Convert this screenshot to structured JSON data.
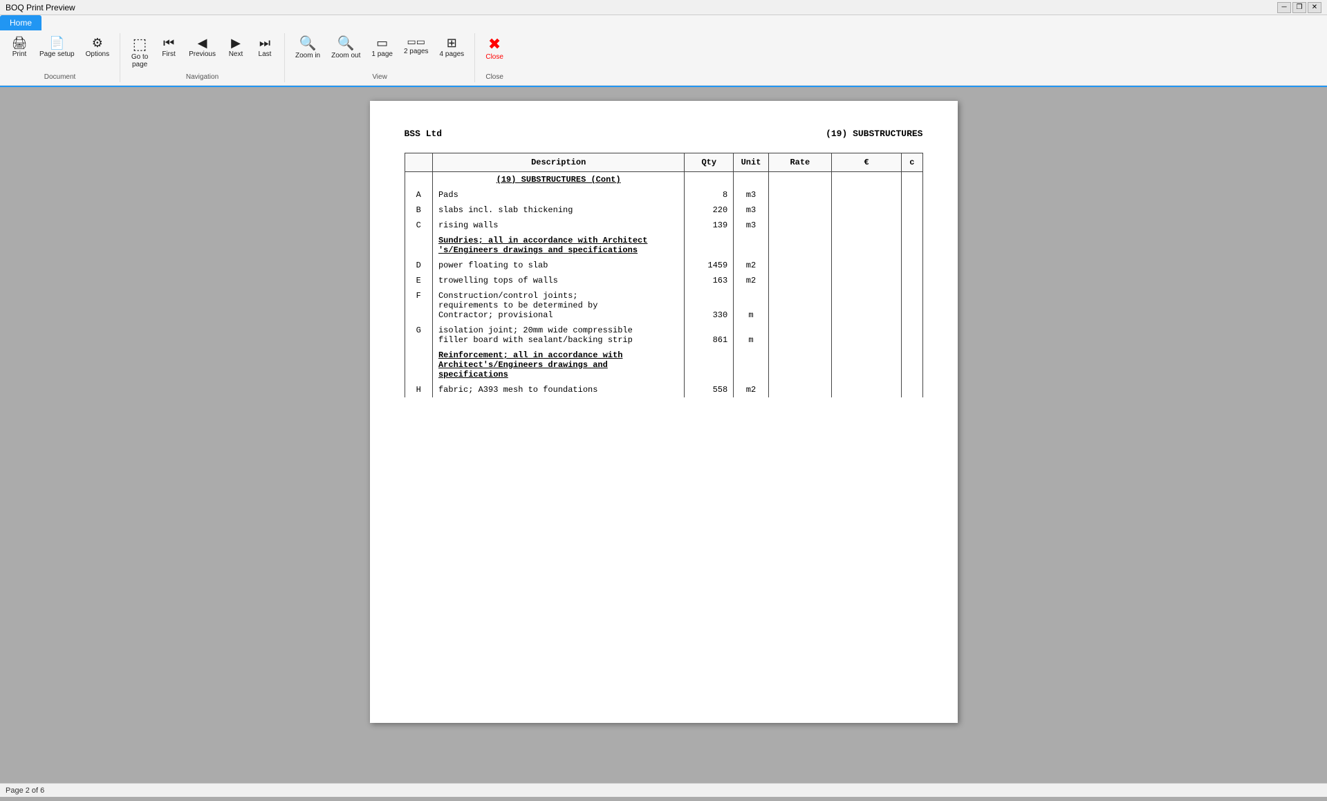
{
  "titleBar": {
    "title": "BOQ Print Preview",
    "buttons": [
      "minimize",
      "restore",
      "close"
    ]
  },
  "ribbon": {
    "activeTab": "Home",
    "tabs": [
      "Home"
    ],
    "groups": [
      {
        "label": "Document",
        "buttons": [
          {
            "id": "print",
            "icon": "🖨",
            "label": "Print"
          },
          {
            "id": "page-setup",
            "icon": "📄",
            "label": "Page setup"
          },
          {
            "id": "options",
            "icon": "⚙",
            "label": "Options"
          }
        ]
      },
      {
        "label": "Navigation",
        "buttons": [
          {
            "id": "go-to-page",
            "icon": "↗",
            "label": "Go to\npage"
          },
          {
            "id": "first",
            "icon": "⏮",
            "label": "First"
          },
          {
            "id": "previous",
            "icon": "◀",
            "label": "Previous"
          },
          {
            "id": "next",
            "icon": "▶",
            "label": "Next"
          },
          {
            "id": "last",
            "icon": "⏭",
            "label": "Last"
          }
        ]
      },
      {
        "label": "View",
        "buttons": [
          {
            "id": "zoom-in",
            "icon": "🔍+",
            "label": "Zoom in"
          },
          {
            "id": "zoom-out",
            "icon": "🔍-",
            "label": "Zoom out"
          },
          {
            "id": "1page",
            "icon": "▭",
            "label": "1 page"
          },
          {
            "id": "2pages",
            "icon": "▭▭",
            "label": "2 pages"
          },
          {
            "id": "4pages",
            "icon": "⊞",
            "label": "4 pages"
          }
        ]
      },
      {
        "label": "Close",
        "buttons": [
          {
            "id": "close",
            "icon": "✖",
            "label": "Close"
          }
        ]
      }
    ]
  },
  "page": {
    "companyName": "BSS  Ltd",
    "sectionTitle": "(19)  SUBSTRUCTURES",
    "tableHeaders": [
      "Description",
      "Qty",
      "Unit",
      "Rate",
      "€",
      "c"
    ],
    "sectionHeading": "(19)  SUBSTRUCTURES (Cont)",
    "rows": [
      {
        "ref": "A",
        "desc": "Pads",
        "qty": "8",
        "unit": "m3",
        "rate": "",
        "euro": "",
        "c": ""
      },
      {
        "ref": "B",
        "desc": "slabs incl. slab thickening",
        "qty": "220",
        "unit": "m3",
        "rate": "",
        "euro": "",
        "c": ""
      },
      {
        "ref": "C",
        "desc": "rising walls",
        "qty": "139",
        "unit": "m3",
        "rate": "",
        "euro": "",
        "c": ""
      },
      {
        "ref": "",
        "desc": "Sundries; all in accordance with Architect\n's/Engineers drawings and specifications",
        "qty": "",
        "unit": "",
        "rate": "",
        "euro": "",
        "c": "",
        "heading": true
      },
      {
        "ref": "D",
        "desc": "power floating to slab",
        "qty": "1459",
        "unit": "m2",
        "rate": "",
        "euro": "",
        "c": ""
      },
      {
        "ref": "E",
        "desc": "trowelling tops of walls",
        "qty": "163",
        "unit": "m2",
        "rate": "",
        "euro": "",
        "c": ""
      },
      {
        "ref": "F",
        "desc": "Construction/control joints;\nrequirements to be determined by\nContractor; provisional",
        "qty": "330",
        "unit": "m",
        "rate": "",
        "euro": "",
        "c": ""
      },
      {
        "ref": "G",
        "desc": "isolation joint; 20mm wide compressible\nfiller board with sealant/backing strip",
        "qty": "861",
        "unit": "m",
        "rate": "",
        "euro": "",
        "c": ""
      },
      {
        "ref": "",
        "desc": "Reinforcement; all in accordance with\nArchitect's/Engineers drawings and\nspecifications",
        "qty": "",
        "unit": "",
        "rate": "",
        "euro": "",
        "c": "",
        "heading": true
      },
      {
        "ref": "H",
        "desc": "fabric; A393 mesh to foundations",
        "qty": "558",
        "unit": "m2",
        "rate": "",
        "euro": "",
        "c": ""
      }
    ]
  },
  "statusBar": {
    "text": "Page 2 of 6"
  }
}
